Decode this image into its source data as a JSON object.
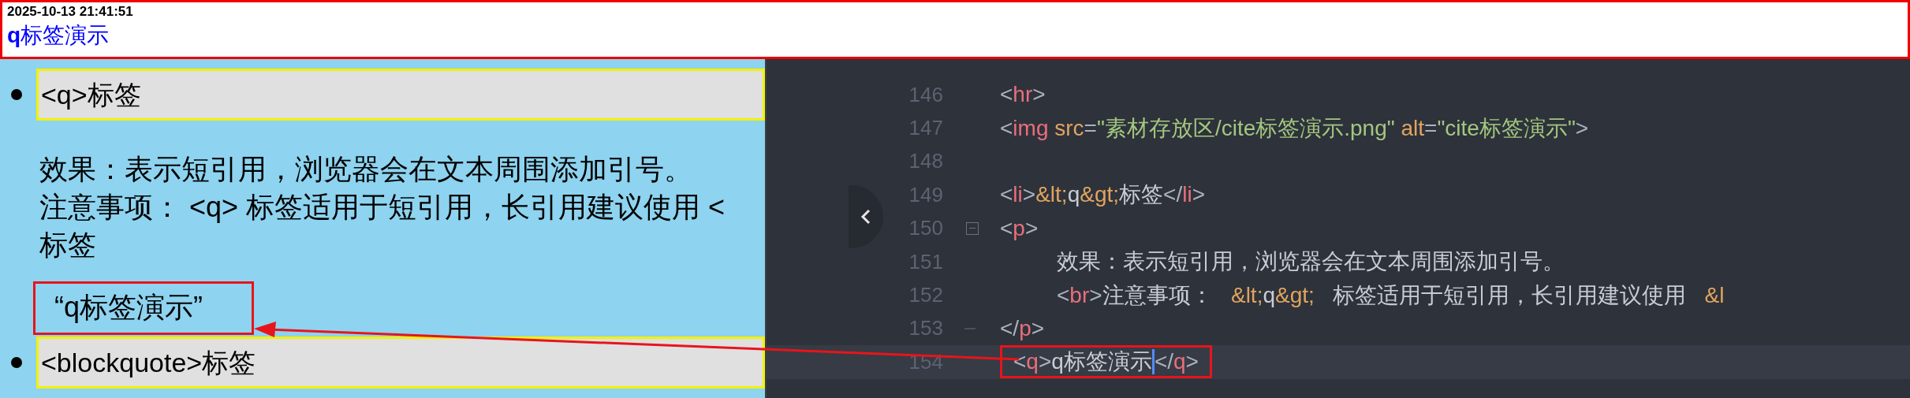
{
  "header": {
    "timestamp": "2025-10-13 21:41:51",
    "title": "**q**标签演示"
  },
  "preview": {
    "items": [
      {
        "kind": "list_item",
        "text": "<q>标签"
      },
      {
        "kind": "paragraph",
        "lines": [
          "效果：表示短引用，浏览器会在文本周围添加引号。",
          "注意事项： <q> 标签适用于短引用，长引用建议使用 <",
          "标签"
        ]
      },
      {
        "kind": "quote",
        "text": "“q标签演示”",
        "highlighted": true
      },
      {
        "kind": "list_item",
        "text": "<blockquote>标签"
      }
    ]
  },
  "editor": {
    "lines": [
      {
        "number": "146",
        "kind": "code",
        "tokens": [
          {
            "kind": "punct",
            "text": "<"
          },
          {
            "kind": "tag",
            "text": "hr"
          },
          {
            "kind": "punct",
            "text": ">"
          }
        ]
      },
      {
        "number": "147",
        "kind": "code",
        "tokens": [
          {
            "kind": "punct",
            "text": "<"
          },
          {
            "kind": "tag",
            "text": "img"
          },
          {
            "kind": "attr",
            "text": " src"
          },
          {
            "kind": "punct",
            "text": "="
          },
          {
            "kind": "string",
            "text": "\"素材存放区/cite标签演示.png\""
          },
          {
            "kind": "attr",
            "text": " alt"
          },
          {
            "kind": "punct",
            "text": "="
          },
          {
            "kind": "string",
            "text": "\"cite标签演示\""
          },
          {
            "kind": "punct",
            "text": ">"
          }
        ]
      },
      {
        "number": "148",
        "kind": "code"
      },
      {
        "number": "149",
        "kind": "code",
        "tokens": [
          {
            "kind": "punct",
            "text": "<"
          },
          {
            "kind": "tag",
            "text": "li"
          },
          {
            "kind": "punct",
            "text": ">"
          },
          {
            "kind": "entity",
            "text": "&lt;"
          },
          {
            "kind": "text",
            "text": "q"
          },
          {
            "kind": "entity",
            "text": "&gt;"
          },
          {
            "kind": "text",
            "text": "标签"
          },
          {
            "kind": "punct",
            "text": "</"
          },
          {
            "kind": "tag",
            "text": "li"
          },
          {
            "kind": "punct",
            "text": ">"
          }
        ]
      },
      {
        "number": "150",
        "kind": "fold_start",
        "tokens": [
          {
            "kind": "punct",
            "text": "<"
          },
          {
            "kind": "tag",
            "text": "p"
          },
          {
            "kind": "punct",
            "text": ">"
          }
        ]
      },
      {
        "number": "151",
        "kind": "code",
        "indented": true,
        "tokens": [
          {
            "kind": "text",
            "text": "效果：表示短引用，浏览器会在文本周围添加引号。"
          }
        ]
      },
      {
        "number": "152",
        "kind": "code",
        "indented": true,
        "tokens": [
          {
            "kind": "punct",
            "text": "<"
          },
          {
            "kind": "tag",
            "text": "br"
          },
          {
            "kind": "punct",
            "text": ">"
          },
          {
            "kind": "text",
            "text": "注意事项：   "
          },
          {
            "kind": "entity",
            "text": "&lt;"
          },
          {
            "kind": "text",
            "text": "q"
          },
          {
            "kind": "entity",
            "text": "&gt;"
          },
          {
            "kind": "text",
            "text": "   标签适用于短引用，长引用建议使用   "
          },
          {
            "kind": "entity",
            "text": "&l"
          }
        ]
      },
      {
        "number": "153",
        "kind": "fold_end",
        "tokens": [
          {
            "kind": "punct",
            "text": "</"
          },
          {
            "kind": "tag",
            "text": "p"
          },
          {
            "kind": "punct",
            "text": ">"
          }
        ]
      },
      {
        "number": "154",
        "kind": "code",
        "current": true,
        "highlighted": true,
        "tokens": [
          {
            "kind": "punct",
            "text": "<"
          },
          {
            "kind": "tag",
            "text": "q"
          },
          {
            "kind": "punct",
            "text": ">"
          },
          {
            "kind": "text",
            "text": "q标签演示"
          },
          {
            "kind": "cursor"
          },
          {
            "kind": "punct",
            "text": "</"
          },
          {
            "kind": "tag",
            "text": "q"
          },
          {
            "kind": "punct",
            "text": ">"
          }
        ]
      }
    ]
  }
}
